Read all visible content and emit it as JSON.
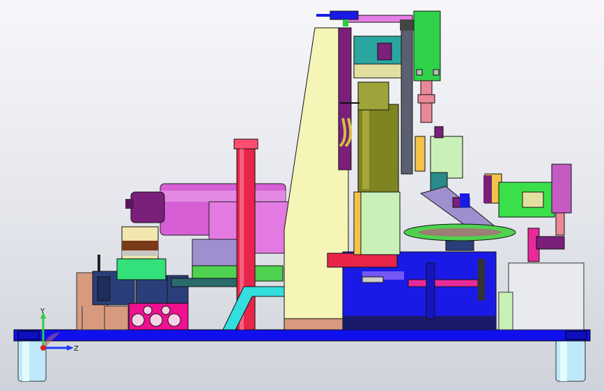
{
  "view": {
    "background_top": "#f7f7fa",
    "background_bottom": "#cfd2da",
    "triad": {
      "y_label": "Y",
      "z_label": "Z",
      "y_color": "#2ecc40",
      "z_color": "#1a3cff",
      "x_color": "#e0201b"
    }
  },
  "model": {
    "colors": {
      "base_plate": "#1010ee",
      "column": "#f6f5b8",
      "motor": "#7f8320",
      "cylinder": "#d65fd6",
      "pillar": "#e8244a",
      "bracket": "#33dede",
      "valve_block": "#f01090",
      "left_block": "#2a3f7a",
      "table": "#1a1ae6",
      "pale_green": "#c9f0b8",
      "green_plate": "#4fd24f",
      "purple": "#7a1f7a",
      "grey": "#cfd0d6",
      "orange_box": "#d79a7e",
      "feet": "#c8f0ff"
    }
  }
}
